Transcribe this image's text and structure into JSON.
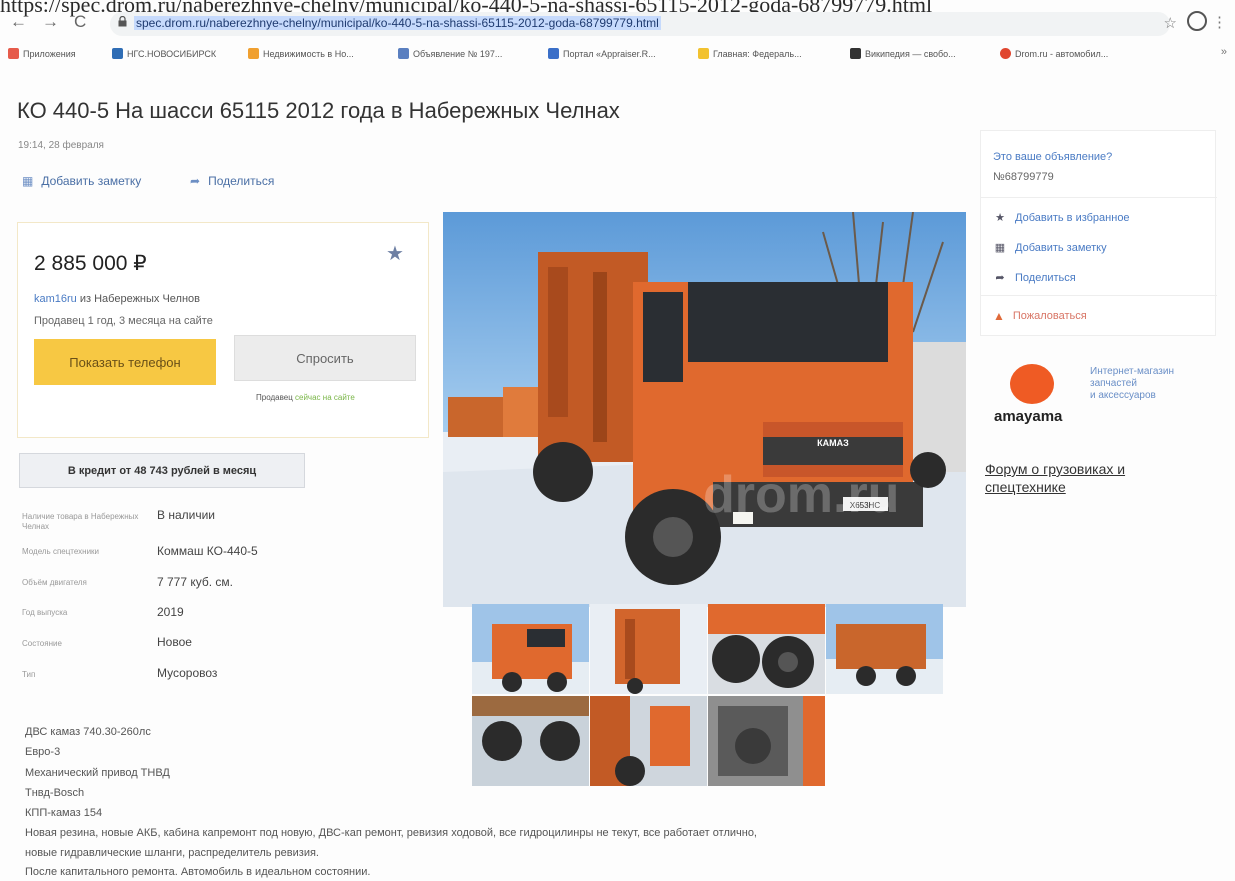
{
  "browser": {
    "top_url_cut": "https://spec.drom.ru/naberezhnye-chelny/municipal/ko-440-5-na-shassi-65115-2012-goda-68799779.html",
    "url": "spec.drom.ru/naberezhnye-chelny/municipal/ko-440-5-na-shassi-65115-2012-goda-68799779.html",
    "nav_back": "←",
    "nav_forward": "→",
    "nav_reload": "C",
    "bookmarks": [
      {
        "label": "Приложения",
        "color": "#e65b4b"
      },
      {
        "label": "НГС.НОВОСИБИРСК",
        "color": "#2f6db5"
      },
      {
        "label": "Недвижимость в Но...",
        "color": "#f0a030"
      },
      {
        "label": "Объявление № 197...",
        "color": "#5a7fc0"
      },
      {
        "label": "Портал «Appraiser.R...",
        "color": "#3b6fc8"
      },
      {
        "label": "Главная: Федераль...",
        "color": "#f2c230"
      },
      {
        "label": "Википедия — свобо...",
        "color": "#333333"
      },
      {
        "label": "Drom.ru - автомобил...",
        "color": "#e0462f"
      }
    ],
    "bookmarks_more": "»"
  },
  "listing": {
    "title": "КО 440-5 На шасси 65115 2012 года в Набережных Челнах",
    "date": "19:14, 28 февраля",
    "add_note": "Добавить заметку",
    "share": "Поделиться",
    "price": "2 885 000 ₽",
    "seller_link": "kam16ru",
    "seller_city": " из Набережных Челнов",
    "seller_age": "Продавец 1 год, 3 месяца на сайте",
    "phone_button": "Показать телефон",
    "ask_button": "Спросить",
    "online_prefix": "Продавец ",
    "online_status": "сейчас на сайте",
    "credit_button": "В кредит от 48 743 рублей в месяц",
    "specs": [
      {
        "label": "Наличие товара в Набережных Челнах",
        "value": "В наличии"
      },
      {
        "label": "Модель спецтехники",
        "value": "Коммаш КО-440-5"
      },
      {
        "label": "Объём двигателя",
        "value": "7 777 куб. см."
      },
      {
        "label": "Год выпуска",
        "value": "2019"
      },
      {
        "label": "Состояние",
        "value": "Новое"
      },
      {
        "label": "Тип",
        "value": "Мусоровоз"
      }
    ],
    "description": [
      "ДВС камаз 740.30-260лс",
      "Евро-3",
      "Механический привод ТНВД",
      "Тнвд-Bosch",
      "КПП-камаз 154",
      "Новая резина, новые АКБ, кабина капремонт под новую, ДВС-кап ремонт, ревизия ходовой, все гидроцилинры не текут, все работает отлично,",
      "новые гидравлические шланги, распределитель ревизия.",
      "После капитального ремонта. Автомобиль в идеальном состоянии."
    ],
    "photo_watermark": "drom.ru",
    "photo_plate": "Х653НС"
  },
  "sidebar": {
    "question": "Это ваше объявление?",
    "ad_id": "№68799779",
    "favorite": "Добавить в избранное",
    "note": "Добавить заметку",
    "share": "Поделиться",
    "report": "Пожаловаться",
    "ad_brand": "amayama",
    "ad_text": [
      "Интернет-магазин",
      "запчастей",
      "и аксессуаров"
    ],
    "forum_line1": "Форум о грузовиках и",
    "forum_line2": "спецтехнике"
  },
  "colors": {
    "accent_link": "#4a7bc4",
    "phone_button": "#f7c843",
    "truck_orange": "#e0692e",
    "report_red": "#d87565",
    "brand_orange": "#ef5b24"
  }
}
